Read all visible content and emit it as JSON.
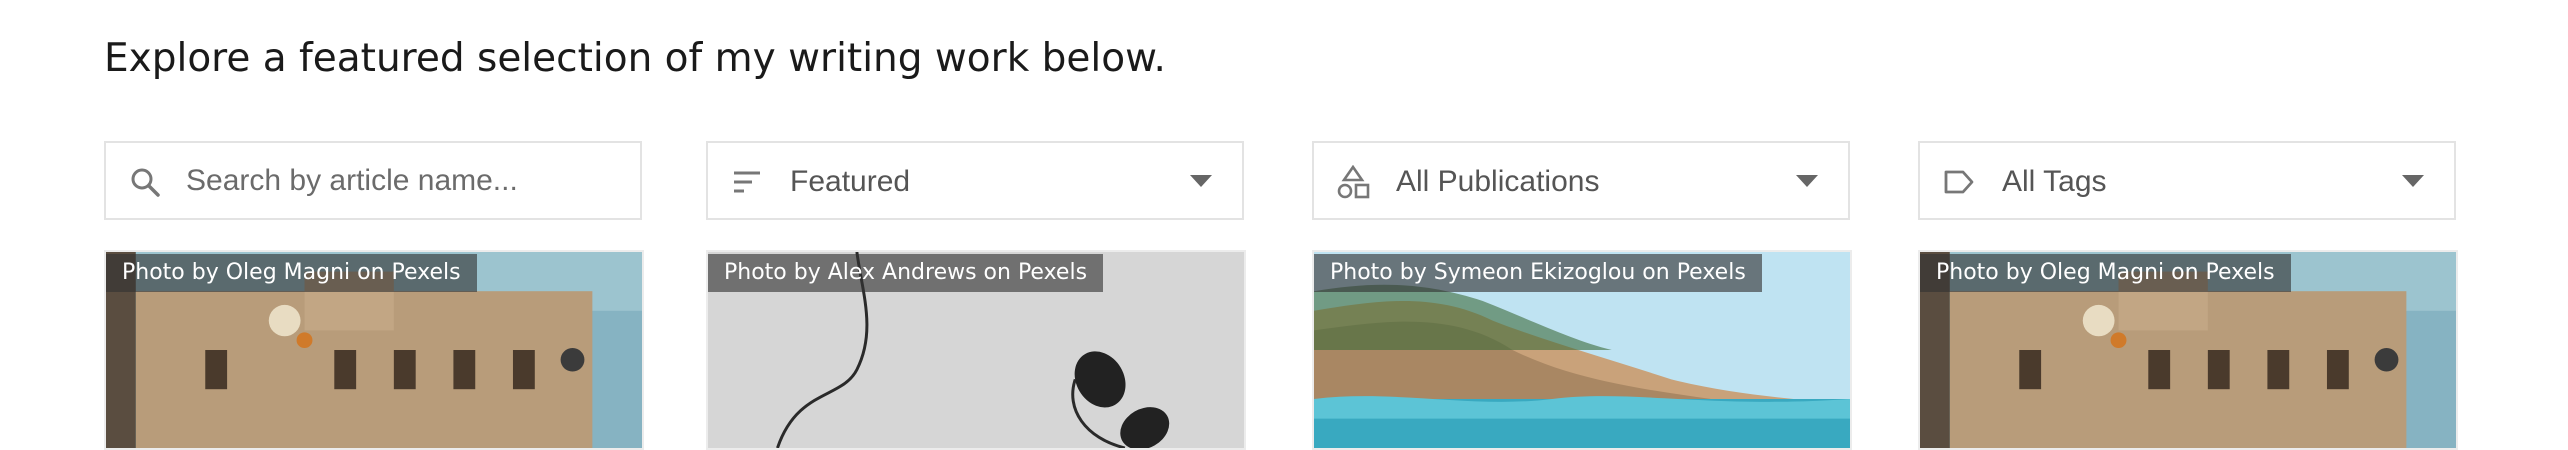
{
  "intro": "Explore a featured selection of my writing work below.",
  "search": {
    "placeholder": "Search by article name..."
  },
  "sort": {
    "selected": "Featured"
  },
  "publications": {
    "selected": "All Publications"
  },
  "tags": {
    "selected": "All Tags"
  },
  "cards": [
    {
      "credit": "Photo by Oleg Magni on Pexels"
    },
    {
      "credit": "Photo by Alex Andrews on Pexels"
    },
    {
      "credit": "Photo by Symeon Ekizoglou on Pexels"
    },
    {
      "credit": "Photo by Oleg Magni on Pexels"
    }
  ],
  "colors": {
    "border": "#e3e3e3",
    "icon": "#777777",
    "text": "#555555"
  }
}
